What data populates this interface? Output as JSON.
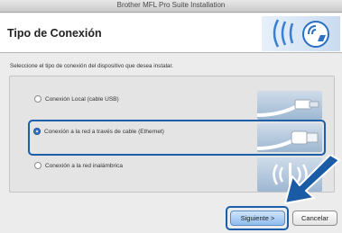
{
  "window": {
    "title": "Brother MFL Pro Suite Installation"
  },
  "header": {
    "title": "Tipo de Conexión"
  },
  "instruction": "Seleccione el tipo de conexión del dispositivo que desea instalar.",
  "options": [
    {
      "label": "Conexión Local (cable USB)",
      "selected": false
    },
    {
      "label": "Conexión a la red a través de cable (Ethernet)",
      "selected": true
    },
    {
      "label": "Conexión a la red inalámbrica",
      "selected": false
    }
  ],
  "buttons": {
    "next": "Siguiente >",
    "cancel": "Cancelar"
  },
  "colors": {
    "highlight": "#1c5ea8",
    "brand": "#2a6fc4"
  },
  "icons": [
    "brand-wireless-logo",
    "usb-cable",
    "ethernet-cable",
    "wireless-waves",
    "pointer-arrow"
  ]
}
